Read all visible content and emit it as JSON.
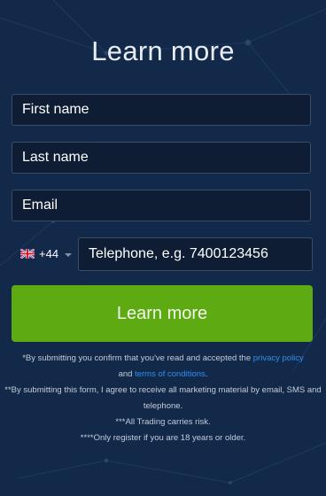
{
  "title": "Learn more",
  "form": {
    "first_name_placeholder": "First name",
    "last_name_placeholder": "Last name",
    "email_placeholder": "Email",
    "country_code": "+44",
    "country_flag_icon": "uk-flag-icon",
    "telephone_placeholder": "Telephone, e.g. 7400123456",
    "submit_label": "Learn more"
  },
  "disclaimer": {
    "line1_prefix": "*By submitting you confirm that you've read and accepted the ",
    "privacy_link": "privacy policy",
    "line1_mid": "and ",
    "terms_link": "terms of conditions",
    "line1_suffix": ".",
    "line2": "**By submitting this form, I agree to receive all marketing material by email, SMS and telephone.",
    "line3": "***All Trading carries risk.",
    "line4": "****Only register if you are 18 years or older."
  },
  "colors": {
    "background": "#13294a",
    "button": "#5daa12",
    "link": "#2d8ff0"
  }
}
